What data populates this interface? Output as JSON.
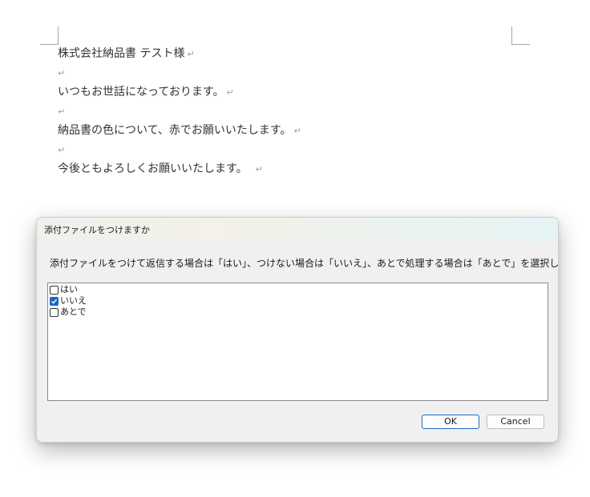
{
  "document": {
    "lines": [
      {
        "text": "株式会社納品書 テスト様",
        "mark": "↵"
      },
      {
        "text": "",
        "mark": "↵"
      },
      {
        "text": "いつもお世話になっております。",
        "mark": "↵"
      },
      {
        "text": "",
        "mark": "↵"
      },
      {
        "text": "納品書の色について、赤でお願いいたします。",
        "mark": "↵"
      },
      {
        "text": "",
        "mark": "↵"
      },
      {
        "text": "今後ともよろしくお願いいたします。",
        "mark": "↵"
      }
    ]
  },
  "dialog": {
    "title": "添付ファイルをつけますか",
    "message": "添付ファイルをつけて返信する場合は「はい」、つけない場合は「いいえ」、あとで処理する場合は「あとで」を選択してください",
    "options": [
      {
        "label": "はい",
        "checked": false
      },
      {
        "label": "いいえ",
        "checked": true
      },
      {
        "label": "あとで",
        "checked": false
      }
    ],
    "ok_label": "OK",
    "cancel_label": "Cancel",
    "accent_color": "#1a66c7"
  }
}
